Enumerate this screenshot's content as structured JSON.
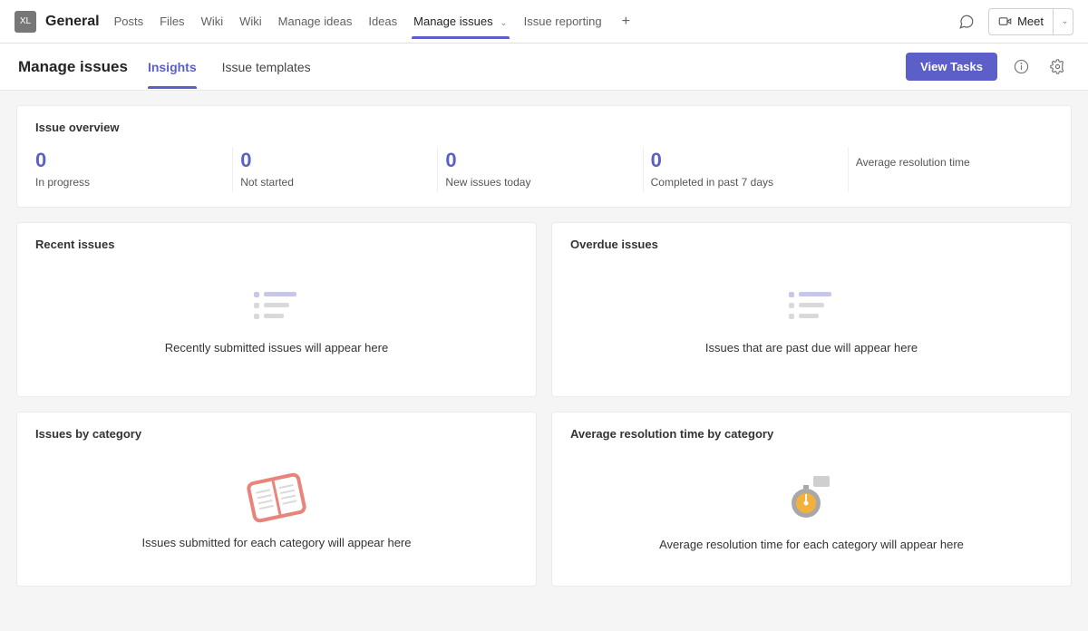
{
  "header": {
    "team_initials": "XL",
    "channel": "General",
    "tabs": [
      "Posts",
      "Files",
      "Wiki",
      "Wiki",
      "Manage ideas",
      "Ideas",
      "Manage issues",
      "Issue reporting"
    ],
    "active_tab_index": 6,
    "meet_label": "Meet"
  },
  "subheader": {
    "title": "Manage issues",
    "tabs": [
      "Insights",
      "Issue templates"
    ],
    "active_tab_index": 0,
    "view_tasks_label": "View Tasks"
  },
  "overview": {
    "title": "Issue overview",
    "stats": [
      {
        "value": "0",
        "label": "In progress"
      },
      {
        "value": "0",
        "label": "Not started"
      },
      {
        "value": "0",
        "label": "New issues today"
      },
      {
        "value": "0",
        "label": "Completed in past 7 days"
      },
      {
        "value": "",
        "label": "Average resolution time"
      }
    ]
  },
  "panels": {
    "recent": {
      "title": "Recent issues",
      "empty": "Recently submitted issues will appear here"
    },
    "overdue": {
      "title": "Overdue issues",
      "empty": "Issues that are past due will appear here"
    },
    "by_category": {
      "title": "Issues by category",
      "empty": "Issues submitted for each category will appear here"
    },
    "avg_by_category": {
      "title": "Average resolution time by category",
      "empty": "Average resolution time for each category will appear here"
    }
  }
}
